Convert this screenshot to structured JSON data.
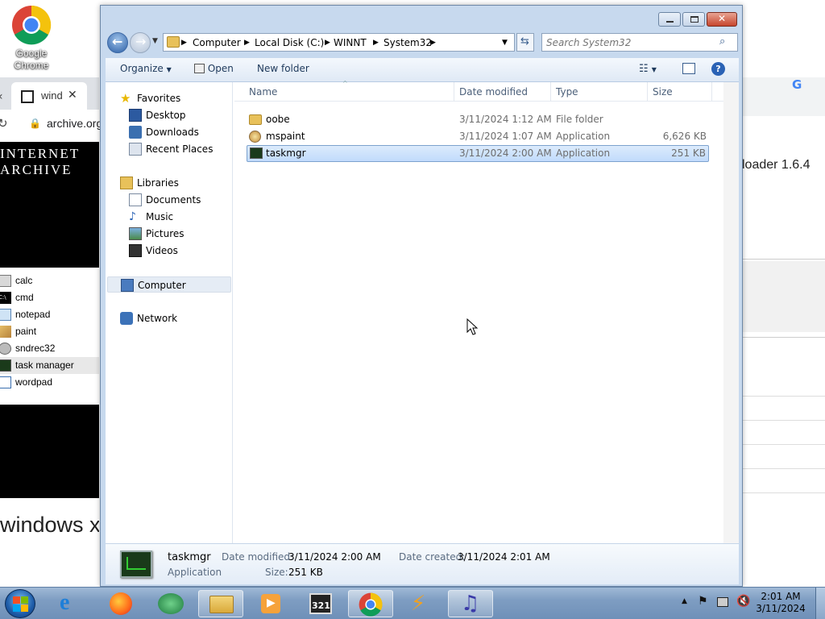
{
  "desktop": {
    "icon_label_line1": "Google",
    "icon_label_line2": "Chrome"
  },
  "background_window": {
    "tab_title": "wind",
    "address": "archive.org",
    "banner_line1": "INTERNET",
    "banner_line2": "ARCHIVE",
    "list_items": [
      "calc",
      "cmd",
      "notepad",
      "paint",
      "sndrec32",
      "task manager",
      "wordpad"
    ],
    "big_text": "windows xp",
    "right_text": "loader 1.6.4"
  },
  "explorer": {
    "breadcrumb": [
      "Computer",
      "Local Disk (C:)",
      "WINNT",
      "System32"
    ],
    "search_placeholder": "Search System32",
    "toolbar": {
      "organize": "Organize",
      "open": "Open",
      "new_folder": "New folder"
    },
    "nav": {
      "favorites": "Favorites",
      "favorites_items": [
        "Desktop",
        "Downloads",
        "Recent Places"
      ],
      "libraries": "Libraries",
      "libraries_items": [
        "Documents",
        "Music",
        "Pictures",
        "Videos"
      ],
      "computer": "Computer",
      "network": "Network"
    },
    "columns": [
      "Name",
      "Date modified",
      "Type",
      "Size"
    ],
    "files": [
      {
        "name": "oobe",
        "date": "3/11/2024 1:12 AM",
        "type": "File folder",
        "size": "",
        "icon": "folder-icon"
      },
      {
        "name": "mspaint",
        "date": "3/11/2024 1:07 AM",
        "type": "Application",
        "size": "6,626 KB",
        "icon": "paint-app-icon"
      },
      {
        "name": "taskmgr",
        "date": "3/11/2024 2:00 AM",
        "type": "Application",
        "size": "251 KB",
        "icon": "taskmgr-app-icon",
        "selected": true
      }
    ],
    "details": {
      "name": "taskmgr",
      "kind": "Application",
      "date_modified_label": "Date modified:",
      "date_modified": "3/11/2024 2:00 AM",
      "date_created_label": "Date created:",
      "date_created": "3/11/2024 2:01 AM",
      "size_label": "Size:",
      "size": "251 KB"
    }
  },
  "taskbar": {
    "items": [
      "start-orb",
      "internet-explorer",
      "firefox",
      "app-green",
      "windows-explorer",
      "media-player",
      "media-player-classic",
      "chrome",
      "winamp",
      "music-app"
    ],
    "clock_time": "2:01 AM",
    "clock_date": "3/11/2024"
  },
  "colors": {
    "selection": "#c1dbfc",
    "accent": "#1e395b"
  }
}
